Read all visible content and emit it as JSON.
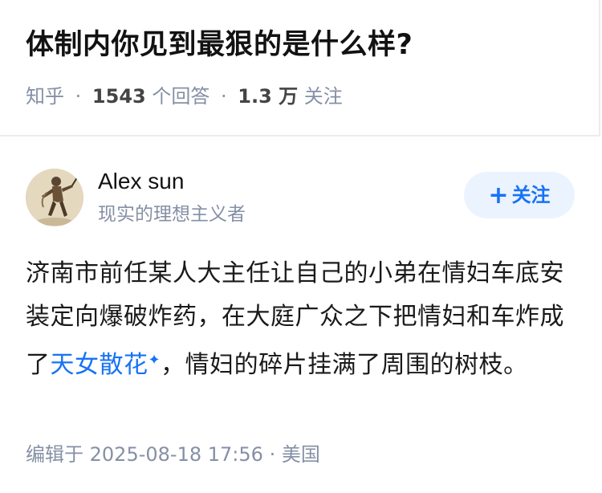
{
  "question": {
    "title": "体制内你见到最狠的是什么样?",
    "source": "知乎",
    "answer_count": "1543",
    "answer_unit": "个回答",
    "follower_count": "1.3 万",
    "follower_unit": "关注",
    "separator": "·"
  },
  "answer": {
    "author_name": "Alex sun",
    "author_bio": "现实的理想主义者",
    "follow_label": "关注",
    "follow_plus": "+",
    "body_part1": "济南市前任某人大主任让自己的小弟在情妇车底安装定向爆破炸药，在大庭广众之下把情妇和车炸成了",
    "body_link": "天女散花",
    "body_sparkle": "✦",
    "body_part2": "，情妇的碎片挂满了周围的树枝。",
    "edited_label": "编辑于",
    "edited_time": "2025-08-18 17:56",
    "location_sep": "·",
    "location": "美国"
  }
}
